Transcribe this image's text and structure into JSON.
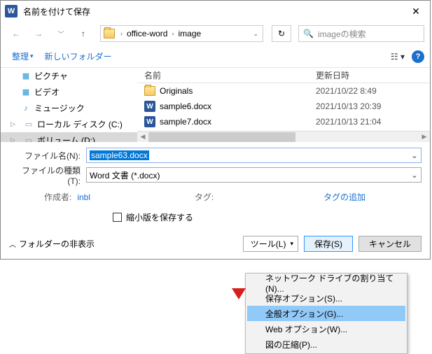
{
  "title": "名前を付けて保存",
  "path": {
    "seg1": "office-word",
    "seg2": "image"
  },
  "search_placeholder": "imageの検索",
  "toolbar": {
    "organize": "整理",
    "newfolder": "新しいフォルダー"
  },
  "tree": {
    "pictures": "ピクチャ",
    "video": "ビデオ",
    "music": "ミュージック",
    "localdisk": "ローカル ディスク (C:)",
    "volume": "ボリューム (D:)"
  },
  "cols": {
    "name": "名前",
    "date": "更新日時"
  },
  "files": [
    {
      "name": "Originals",
      "date": "2021/10/22 8:49",
      "type": "folder"
    },
    {
      "name": "sample6.docx",
      "date": "2021/10/13 20:39",
      "type": "docx"
    },
    {
      "name": "sample7.docx",
      "date": "2021/10/13 21:04",
      "type": "docx"
    }
  ],
  "form": {
    "filename_label": "ファイル名(N):",
    "filename_value": "sample63.docx",
    "filetype_label": "ファイルの種類(T):",
    "filetype_value": "Word 文書 (*.docx)",
    "author_label": "作成者:",
    "author_value": "inbl",
    "tag_label": "タグ:",
    "tag_value": "タグの追加",
    "thumb_label": "縮小版を保存する"
  },
  "footer": {
    "collapse": "フォルダーの非表示",
    "tools": "ツール(L)",
    "save": "保存(S)",
    "cancel": "キャンセル"
  },
  "menu": {
    "net": "ネットワーク ドライブの割り当て(N)...",
    "saveopt": "保存オプション(S)...",
    "genopt": "全般オプション(G)...",
    "webopt": "Web オプション(W)...",
    "compress": "図の圧縮(P)..."
  }
}
